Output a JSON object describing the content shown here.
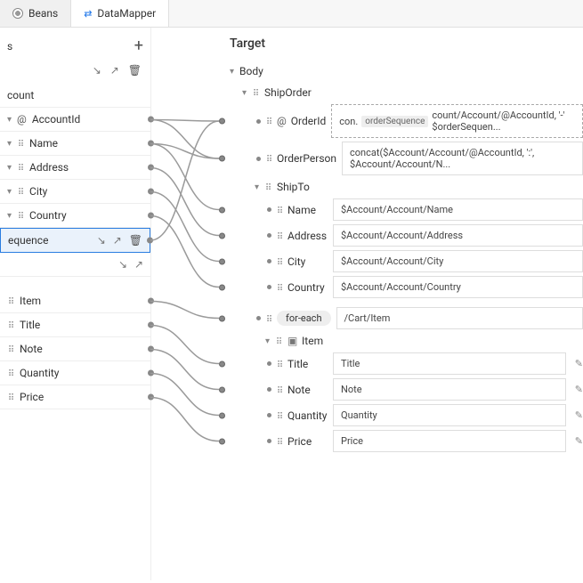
{
  "tabs": {
    "beans": "Beans",
    "mapper": "DataMapper"
  },
  "sourceHeader": "s",
  "sourceItems": [
    {
      "label": "count"
    },
    {
      "label": "AccountId",
      "hasAttr": true
    },
    {
      "label": "Name"
    },
    {
      "label": "Address"
    },
    {
      "label": "City"
    },
    {
      "label": "Country"
    },
    {
      "label": "equence",
      "highlight": true,
      "showBtns": true
    }
  ],
  "sourceBlank": {
    "showBtns": true
  },
  "sourceCart": [
    {
      "label": "Item",
      "icon": "cube"
    },
    {
      "label": "Title"
    },
    {
      "label": "Note"
    },
    {
      "label": "Quantity"
    },
    {
      "label": "Price"
    }
  ],
  "target": {
    "title": "Target",
    "body": "Body",
    "shipOrder": "ShipOrder",
    "rows": {
      "orderId": {
        "name": "OrderId",
        "value": "con.",
        "hint": "orderSequence",
        "tail": "count/Account/@AccountId, '-' $orderSequen..."
      },
      "orderPerson": {
        "name": "OrderPerson",
        "value": "concat($Account/Account/@AccountId, ':', $Account/Account/N..."
      },
      "shipTo": "ShipTo",
      "name": {
        "name": "Name",
        "value": "$Account/Account/Name"
      },
      "address": {
        "name": "Address",
        "value": "$Account/Account/Address"
      },
      "city": {
        "name": "City",
        "value": "$Account/Account/City"
      },
      "country": {
        "name": "Country",
        "value": "$Account/Account/Country"
      },
      "foreach": {
        "name": "for-each",
        "value": "/Cart/Item"
      },
      "item": "Item",
      "title": {
        "name": "Title",
        "value": "Title"
      },
      "note": {
        "name": "Note",
        "value": "Note"
      },
      "quantity": {
        "name": "Quantity",
        "value": "Quantity"
      },
      "price": {
        "name": "Price",
        "value": "Price"
      }
    }
  }
}
